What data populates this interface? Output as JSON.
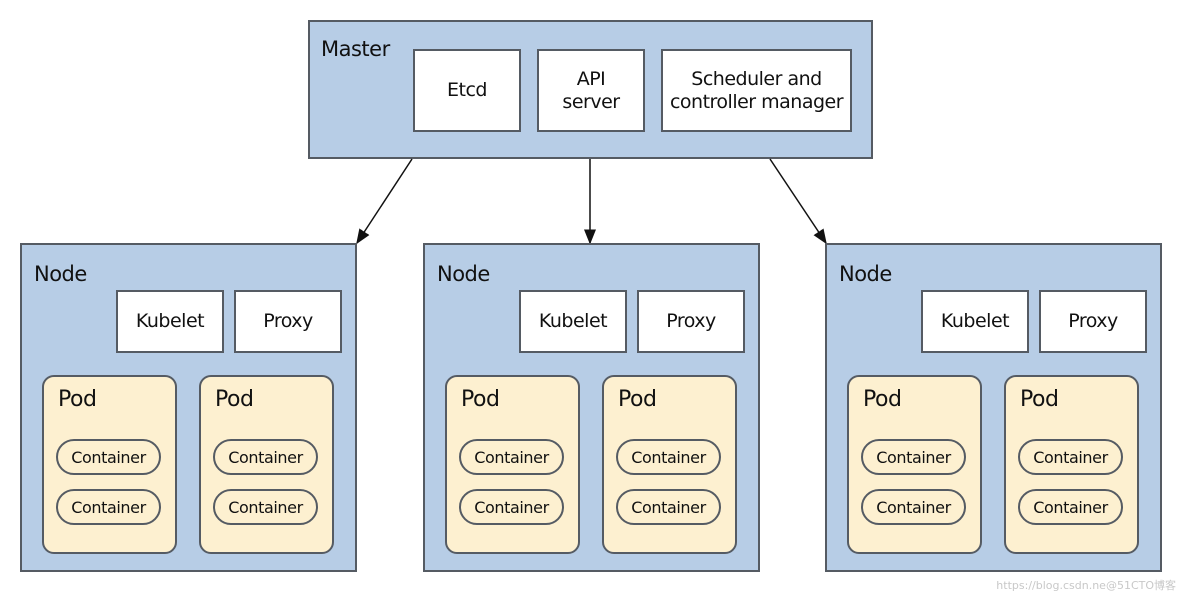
{
  "master": {
    "title": "Master",
    "components": [
      "Etcd",
      "API\nserver",
      "Scheduler and\ncontroller manager"
    ]
  },
  "nodes": [
    {
      "title": "Node",
      "kubelet": "Kubelet",
      "proxy": "Proxy",
      "pods": [
        {
          "title": "Pod",
          "containers": [
            "Container",
            "Container"
          ]
        },
        {
          "title": "Pod",
          "containers": [
            "Container",
            "Container"
          ]
        }
      ]
    },
    {
      "title": "Node",
      "kubelet": "Kubelet",
      "proxy": "Proxy",
      "pods": [
        {
          "title": "Pod",
          "containers": [
            "Container",
            "Container"
          ]
        },
        {
          "title": "Pod",
          "containers": [
            "Container",
            "Container"
          ]
        }
      ]
    },
    {
      "title": "Node",
      "kubelet": "Kubelet",
      "proxy": "Proxy",
      "pods": [
        {
          "title": "Pod",
          "containers": [
            "Container",
            "Container"
          ]
        },
        {
          "title": "Pod",
          "containers": [
            "Container",
            "Container"
          ]
        }
      ]
    }
  ],
  "colors": {
    "node_fill": "#b7cde6",
    "pod_fill": "#fdf0d0",
    "border": "#555b63"
  },
  "watermark": "https://blog.csdn.ne@51CTO博客"
}
